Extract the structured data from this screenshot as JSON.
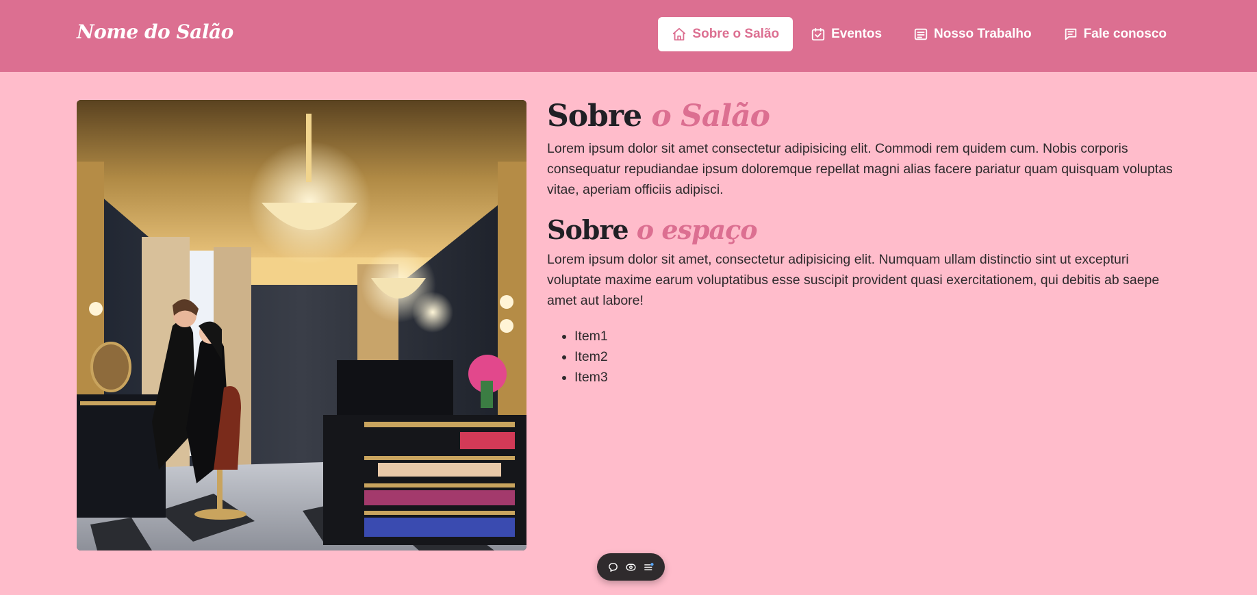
{
  "navbar": {
    "brand": "Nome do Salão",
    "links": [
      {
        "label": "Sobre o Salão",
        "icon": "home-icon",
        "active": true
      },
      {
        "label": "Eventos",
        "icon": "calendar-check-icon",
        "active": false
      },
      {
        "label": "Nosso Trabalho",
        "icon": "list-box-icon",
        "active": false
      },
      {
        "label": "Fale conosco",
        "icon": "chat-lines-icon",
        "active": false
      }
    ]
  },
  "about": {
    "title_word": "Sobre",
    "title_accent": "o Salão",
    "text": "Lorem ipsum dolor sit amet consectetur adipisicing elit. Commodi rem quidem cum. Nobis corporis consequatur repudiandae ipsum doloremque repellat magni alias facere pariatur quam quisquam voluptas vitae, aperiam officiis adipisci."
  },
  "space": {
    "title_word": "Sobre",
    "title_accent": "o espaço",
    "text": "Lorem ipsum dolor sit amet, consectetur adipisicing elit. Numquam ullam distinctio sint ut excepturi voluptate maxime earum voluptatibus esse suscipit provident quasi exercitationem, qui debitis ab saepe amet aut labore!",
    "items": [
      "Item1",
      "Item2",
      "Item3"
    ]
  },
  "toolbar": {
    "icons": [
      "comment-icon",
      "eye-icon",
      "menu-badge-icon"
    ]
  },
  "colors": {
    "page_background": "#FFBCCB",
    "navbar": "#DC6F91",
    "accent": "#DC6F91",
    "heading": "#202025",
    "toolbar": "#2f2b2d"
  }
}
